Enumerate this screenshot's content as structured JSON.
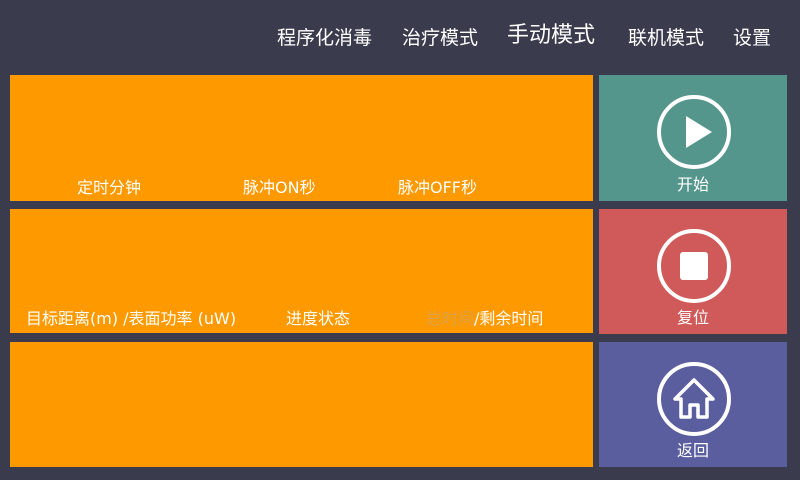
{
  "nav": {
    "items": [
      {
        "label": "程序化消毒"
      },
      {
        "label": "治疗模式"
      },
      {
        "label": "手动模式",
        "active": true
      },
      {
        "label": "联机模式"
      },
      {
        "label": "设置"
      }
    ]
  },
  "panel1": {
    "timer_label": "定时分钟",
    "pulse_on_label": "脉冲ON秒",
    "pulse_off_label": "脉冲OFF秒"
  },
  "panel2": {
    "distance_power_label": "目标距离(m) /表面功率 (uW)",
    "progress_label": "进度状态",
    "total_time_label": "总时间",
    "slash": "/",
    "remaining_time_label": "剩余时间"
  },
  "buttons": {
    "start": {
      "label": "开始",
      "color": "#55968c",
      "icon": "play-icon"
    },
    "reset": {
      "label": "复位",
      "color": "#d05a5a",
      "icon": "stop-icon"
    },
    "back": {
      "label": "返回",
      "color": "#5a5e9e",
      "icon": "home-icon"
    }
  },
  "colors": {
    "background": "#3a3b4d",
    "panel": "#ff9900"
  }
}
